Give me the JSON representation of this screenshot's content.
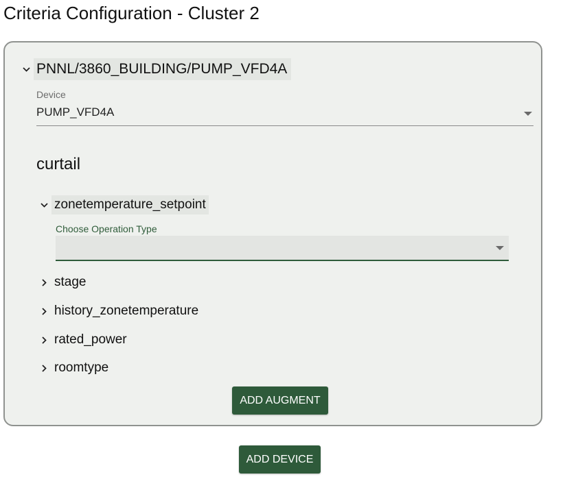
{
  "page": {
    "title": "Criteria Configuration - Cluster 2"
  },
  "device_section": {
    "path": "PNNL/3860_BUILDING/PUMP_VFD4A",
    "device_label": "Device",
    "device_value": "PUMP_VFD4A"
  },
  "curtail": {
    "heading": "curtail",
    "points": [
      {
        "label": "zonetemperature_setpoint",
        "expanded": true
      },
      {
        "label": "stage",
        "expanded": false
      },
      {
        "label": "history_zonetemperature",
        "expanded": false
      },
      {
        "label": "rated_power",
        "expanded": false
      },
      {
        "label": "roomtype",
        "expanded": false
      }
    ],
    "operation_type_label": "Choose Operation Type",
    "operation_type_value": ""
  },
  "buttons": {
    "add_augment": "ADD AUGMENT",
    "add_device": "ADD DEVICE"
  },
  "colors": {
    "accent": "#2e5a3a",
    "card_bg": "#eff1ee",
    "card_border": "#8f928f"
  },
  "icons": {
    "expanded": "chevron-down-icon",
    "collapsed": "chevron-right-icon",
    "dropdown": "caret-down-icon"
  }
}
